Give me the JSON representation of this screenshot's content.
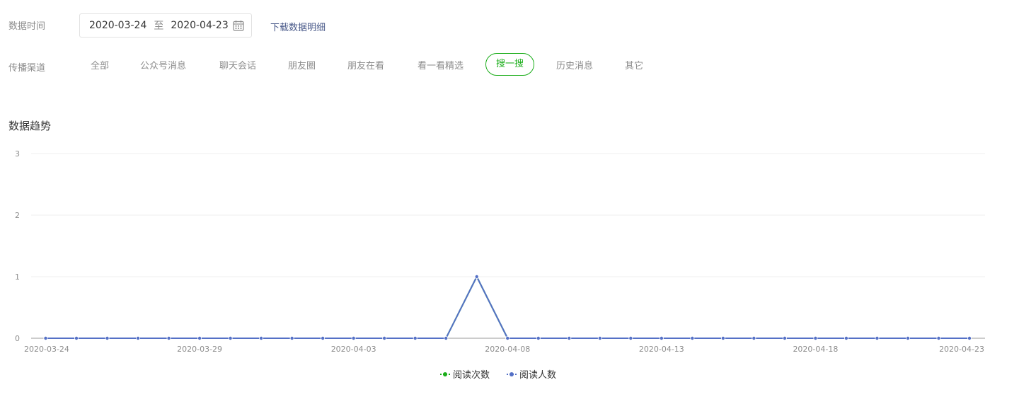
{
  "filters": {
    "date_label": "数据时间",
    "date_start": "2020-03-24",
    "date_sep": "至",
    "date_end": "2020-04-23",
    "download_label": "下载数据明细",
    "channel_label": "传播渠道",
    "channels": [
      "全部",
      "公众号消息",
      "聊天会话",
      "朋友圈",
      "朋友在看",
      "看一看精选",
      "搜一搜",
      "历史消息",
      "其它"
    ],
    "active_channel": "搜一搜"
  },
  "section_title": "数据趋势",
  "colors": {
    "accent": "#1aad19",
    "series_reads": "#1aad19",
    "series_readers": "#5470c6"
  },
  "chart_data": {
    "type": "line",
    "x": [
      "2020-03-24",
      "2020-03-25",
      "2020-03-26",
      "2020-03-27",
      "2020-03-28",
      "2020-03-29",
      "2020-03-30",
      "2020-03-31",
      "2020-04-01",
      "2020-04-02",
      "2020-04-03",
      "2020-04-04",
      "2020-04-05",
      "2020-04-06",
      "2020-04-07",
      "2020-04-08",
      "2020-04-09",
      "2020-04-10",
      "2020-04-11",
      "2020-04-12",
      "2020-04-13",
      "2020-04-14",
      "2020-04-15",
      "2020-04-16",
      "2020-04-17",
      "2020-04-18",
      "2020-04-19",
      "2020-04-20",
      "2020-04-21",
      "2020-04-22",
      "2020-04-23"
    ],
    "x_tick_labels": [
      "2020-03-24",
      "2020-03-29",
      "2020-04-03",
      "2020-04-08",
      "2020-04-13",
      "2020-04-18",
      "2020-04-23"
    ],
    "y_tick_labels": [
      "0",
      "1",
      "2",
      "3"
    ],
    "ylim": [
      0,
      3
    ],
    "grid": true,
    "legend_position": "bottom",
    "series": [
      {
        "name": "阅读次数",
        "values": [
          0,
          0,
          0,
          0,
          0,
          0,
          0,
          0,
          0,
          0,
          0,
          0,
          0,
          0,
          1,
          0,
          0,
          0,
          0,
          0,
          0,
          0,
          0,
          0,
          0,
          0,
          0,
          0,
          0,
          0,
          0
        ]
      },
      {
        "name": "阅读人数",
        "values": [
          0,
          0,
          0,
          0,
          0,
          0,
          0,
          0,
          0,
          0,
          0,
          0,
          0,
          0,
          1,
          0,
          0,
          0,
          0,
          0,
          0,
          0,
          0,
          0,
          0,
          0,
          0,
          0,
          0,
          0,
          0
        ]
      }
    ]
  }
}
